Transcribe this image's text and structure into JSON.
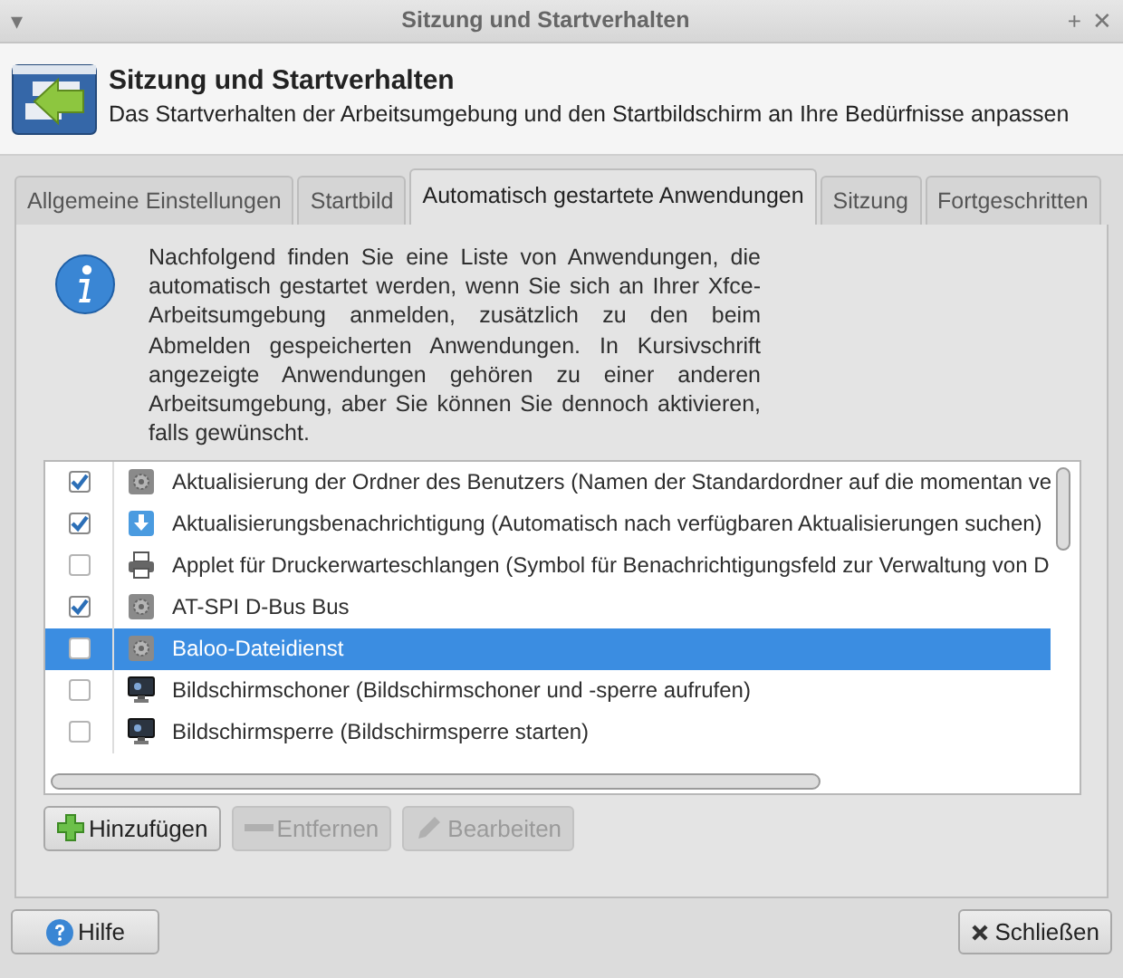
{
  "window": {
    "title": "Sitzung und Startverhalten",
    "menu_glyph": "▾",
    "maximize_glyph": "+",
    "close_glyph": "✕"
  },
  "header": {
    "title": "Sitzung und Startverhalten",
    "subtitle": "Das Startverhalten der Arbeitsumgebung und den Startbildschirm an Ihre Bedürfnisse anpassen"
  },
  "tabs": [
    {
      "label": "Allgemeine Einstellungen",
      "selected": false
    },
    {
      "label": "Startbild",
      "selected": false
    },
    {
      "label": "Automatisch gestartete Anwendungen",
      "selected": true
    },
    {
      "label": "Sitzung",
      "selected": false
    },
    {
      "label": "Fortgeschritten",
      "selected": false
    }
  ],
  "info_text": "Nachfolgend finden Sie eine Liste von Anwendungen, die automatisch gestartet werden, wenn Sie sich an Ihrer Xfce-Arbeitsumgebung anmelden, zusätzlich zu den beim Abmelden gespeicherten Anwendungen. In Kursivschrift angezeigte Anwendungen gehören zu einer anderen Arbeitsumgebung, aber Sie können Sie dennoch aktivieren, falls gewünscht.",
  "applications": [
    {
      "label": "Aktualisierung der Ordner des Benutzers (Namen der Standardordner auf die momentan ve",
      "checked": true,
      "selected": false,
      "kind": "gear"
    },
    {
      "label": "Aktualisierungsbenachrichtigung (Automatisch nach verfügbaren Aktualisierungen suchen)",
      "checked": true,
      "selected": false,
      "kind": "download"
    },
    {
      "label": "Applet für Druckerwarteschlangen (Symbol für Benachrichtigungsfeld zur Verwaltung von D",
      "checked": false,
      "selected": false,
      "kind": "printer"
    },
    {
      "label": "AT-SPI D-Bus Bus",
      "checked": true,
      "selected": false,
      "kind": "gear"
    },
    {
      "label": "Baloo-Dateidienst",
      "checked": false,
      "selected": true,
      "kind": "gear"
    },
    {
      "label": "Bildschirmschoner (Bildschirmschoner und -sperre aufrufen)",
      "checked": false,
      "selected": false,
      "kind": "monitor"
    },
    {
      "label": "Bildschirmsperre (Bildschirmsperre starten)",
      "checked": false,
      "selected": false,
      "kind": "monitor"
    }
  ],
  "list_buttons": [
    {
      "label": "Hinzufügen",
      "disabled": false,
      "kind": "add"
    },
    {
      "label": "Entfernen",
      "disabled": true,
      "kind": "remove"
    },
    {
      "label": "Bearbeiten",
      "disabled": true,
      "kind": "edit"
    }
  ],
  "footer": {
    "help": "Hilfe",
    "close": "Schließen"
  }
}
